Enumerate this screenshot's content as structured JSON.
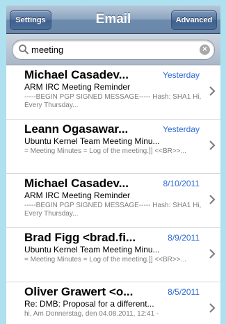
{
  "navbar": {
    "left_button": "Settings",
    "title": "Email",
    "right_button": "Advanced"
  },
  "search": {
    "value": "meeting"
  },
  "messages": [
    {
      "sender": "Michael Casadev...",
      "date": "Yesterday",
      "subject": "ARM IRC Meeting Reminder",
      "preview": "-----BEGIN PGP SIGNED MESSAGE----- Hash: SHA1 Hi,          Every Thursday..."
    },
    {
      "sender": "Leann Ogasawar...",
      "date": "Yesterday",
      "subject": "Ubuntu Kernel Team Meeting Minu...",
      "preview": "= Meeting Minutes = Log of the meeting.]] <<BR>>..."
    },
    {
      "sender": "Michael Casadev...",
      "date": "8/10/2011",
      "subject": "ARM IRC Meeting Reminder",
      "preview": "-----BEGIN PGP SIGNED MESSAGE----- Hash: SHA1 Hi,          Every Thursday..."
    },
    {
      "sender": "Brad Figg <brad.fi...",
      "date": "8/9/2011",
      "subject": "Ubuntu Kernel Team Meeting Minu...",
      "preview": "= Meeting Minutes = Log of the meeting.]] <<BR>>..."
    },
    {
      "sender": "Oliver Grawert <o...",
      "date": "8/5/2011",
      "subject": "Re: DMB: Proposal for a different...",
      "preview": "hi, Am Donnerstag, den 04.08.2011, 12:41 -"
    }
  ],
  "colors": {
    "date_blue": "#2f6bd6",
    "navbar_blue": "#6d8bad",
    "background": "#aee0ef"
  },
  "icons": {
    "search": "search-icon",
    "clear": "clear-icon",
    "row_arrow": "chevron-right-icon"
  }
}
